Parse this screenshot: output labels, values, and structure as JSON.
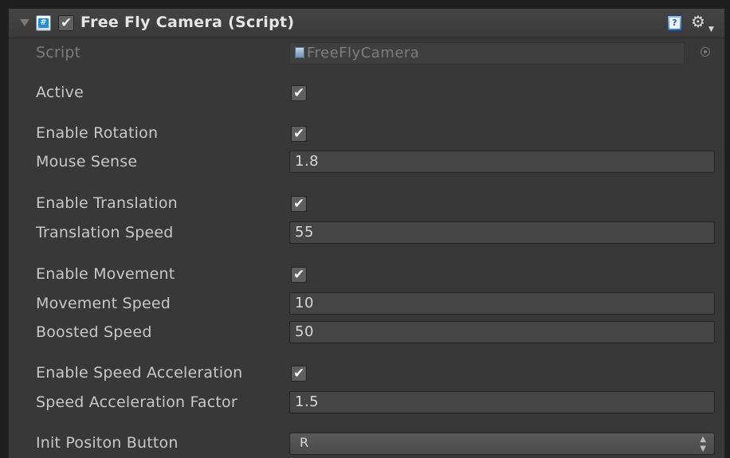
{
  "component": {
    "title": "Free Fly Camera (Script)",
    "enabled": true
  },
  "icons": {
    "foldout": "triangle-down",
    "component": "csharp-script-icon",
    "help": "help-book-icon",
    "settings": "gear-icon",
    "script_field": "script-file-icon",
    "object_picker": "target-circle-icon"
  },
  "script_row": {
    "label": "Script",
    "value": "FreeFlyCamera"
  },
  "fields": {
    "active": {
      "label": "Active",
      "checked": true
    },
    "enable_rotation": {
      "label": "Enable Rotation",
      "checked": true
    },
    "mouse_sense": {
      "label": "Mouse Sense",
      "value": "1.8"
    },
    "enable_translation": {
      "label": "Enable Translation",
      "checked": true
    },
    "translation_speed": {
      "label": "Translation Speed",
      "value": "55"
    },
    "enable_movement": {
      "label": "Enable Movement",
      "checked": true
    },
    "movement_speed": {
      "label": "Movement Speed",
      "value": "10"
    },
    "boosted_speed": {
      "label": "Boosted Speed",
      "value": "50"
    },
    "enable_speed_acceleration": {
      "label": "Enable Speed Acceleration",
      "checked": true
    },
    "speed_acceleration_factor": {
      "label": "Speed Acceleration Factor",
      "value": "1.5"
    },
    "init_position_button": {
      "label": "Init Positon Button",
      "value": "R"
    }
  },
  "colors": {
    "panel": "#383838",
    "field": "#454545",
    "text": "#c8c8c8",
    "accent": "#1e8fd6"
  }
}
